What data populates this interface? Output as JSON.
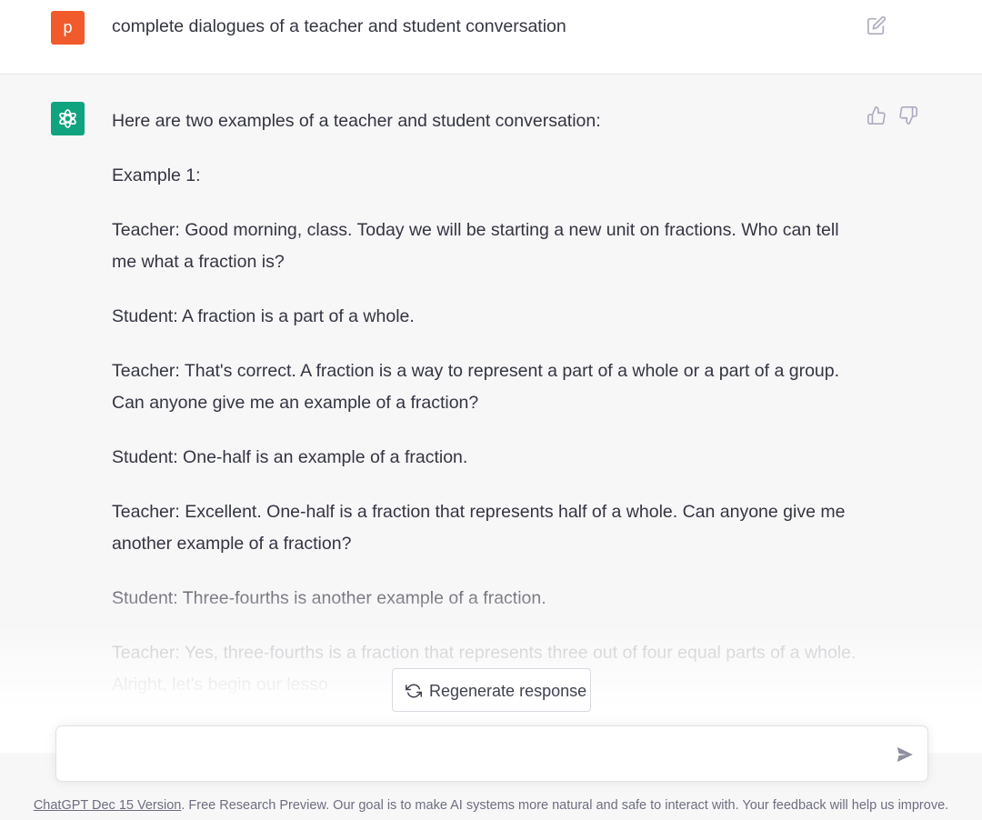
{
  "user_message": {
    "avatar_letter": "p",
    "avatar_color": "#f15a2b",
    "text": "complete dialogues of a teacher and student conversation",
    "edit_icon": "edit-icon"
  },
  "assistant_message": {
    "avatar_color": "#10a37f",
    "avatar_icon": "openai-logo-icon",
    "paragraphs": [
      "Here are two examples of a teacher and student conversation:",
      "Example 1:",
      "Teacher: Good morning, class. Today we will be starting a new unit on fractions. Who can tell me what a fraction is?",
      "Student: A fraction is a part of a whole.",
      "Teacher: That's correct. A fraction is a way to represent a part of a whole or a part of a group. Can anyone give me an example of a fraction?",
      "Student: One-half is an example of a fraction.",
      "Teacher: Excellent. One-half is a fraction that represents half of a whole. Can anyone give me another example of a fraction?",
      "Student: Three-fourths is another example of a fraction.",
      "Teacher: Yes, three-fourths is a fraction that represents three out of four equal parts of a whole. Alright, let's begin our lesso"
    ],
    "feedback_icons": [
      "thumbs-up-icon",
      "thumbs-down-icon"
    ]
  },
  "regenerate": {
    "label": "Regenerate response",
    "icon": "refresh-icon"
  },
  "composer": {
    "value": "",
    "send_icon": "send-icon"
  },
  "footer": {
    "link_text": "ChatGPT Dec 15 Version",
    "text": ". Free Research Preview. Our goal is to make AI systems more natural and safe to interact with. Your feedback will help us improve."
  }
}
